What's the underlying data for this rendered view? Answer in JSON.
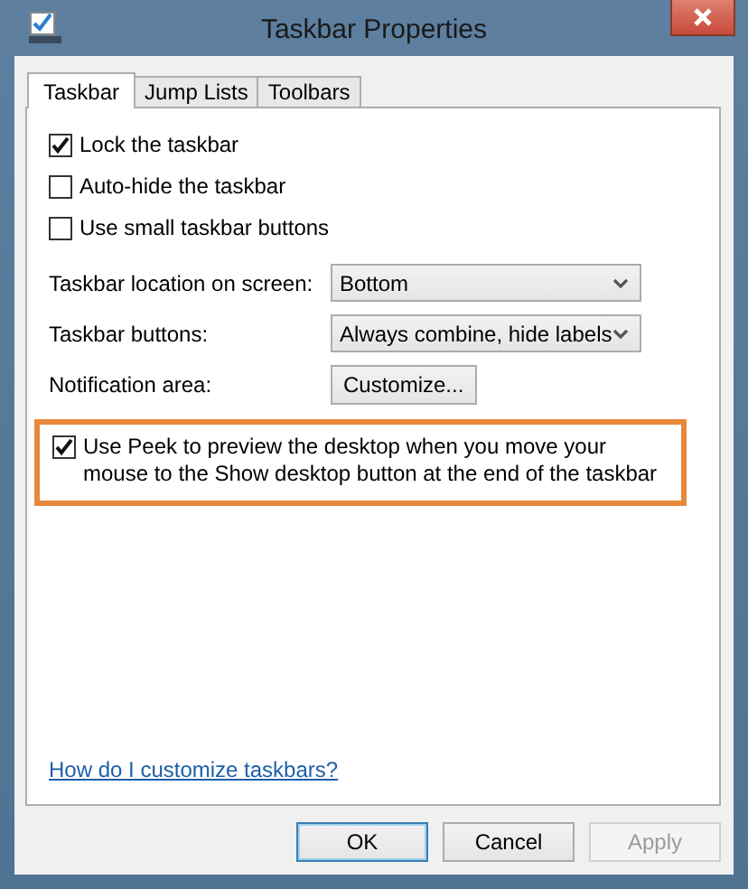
{
  "window": {
    "title": "Taskbar Properties"
  },
  "tabs": [
    {
      "label": "Taskbar",
      "selected": true
    },
    {
      "label": "Jump Lists",
      "selected": false
    },
    {
      "label": "Toolbars",
      "selected": false
    }
  ],
  "options": [
    {
      "label": "Lock the taskbar",
      "checked": true
    },
    {
      "label": "Auto-hide the taskbar",
      "checked": false
    },
    {
      "label": "Use small taskbar buttons",
      "checked": false
    }
  ],
  "settings": [
    {
      "kind": "dropdown",
      "label": "Taskbar location on screen:",
      "value": "Bottom"
    },
    {
      "kind": "dropdown",
      "label": "Taskbar buttons:",
      "value": "Always combine, hide labels"
    },
    {
      "kind": "button",
      "label": "Notification area:",
      "value": "Customize..."
    }
  ],
  "peek": {
    "label": "Use Peek to preview the desktop when you move your mouse to the Show desktop button at the end of the taskbar",
    "checked": true,
    "highlighted": true
  },
  "help_link": "How do I customize taskbars?",
  "buttons": [
    {
      "label": "OK",
      "default": true,
      "disabled": false
    },
    {
      "label": "Cancel",
      "default": false,
      "disabled": false
    },
    {
      "label": "Apply",
      "default": false,
      "disabled": true
    }
  ]
}
